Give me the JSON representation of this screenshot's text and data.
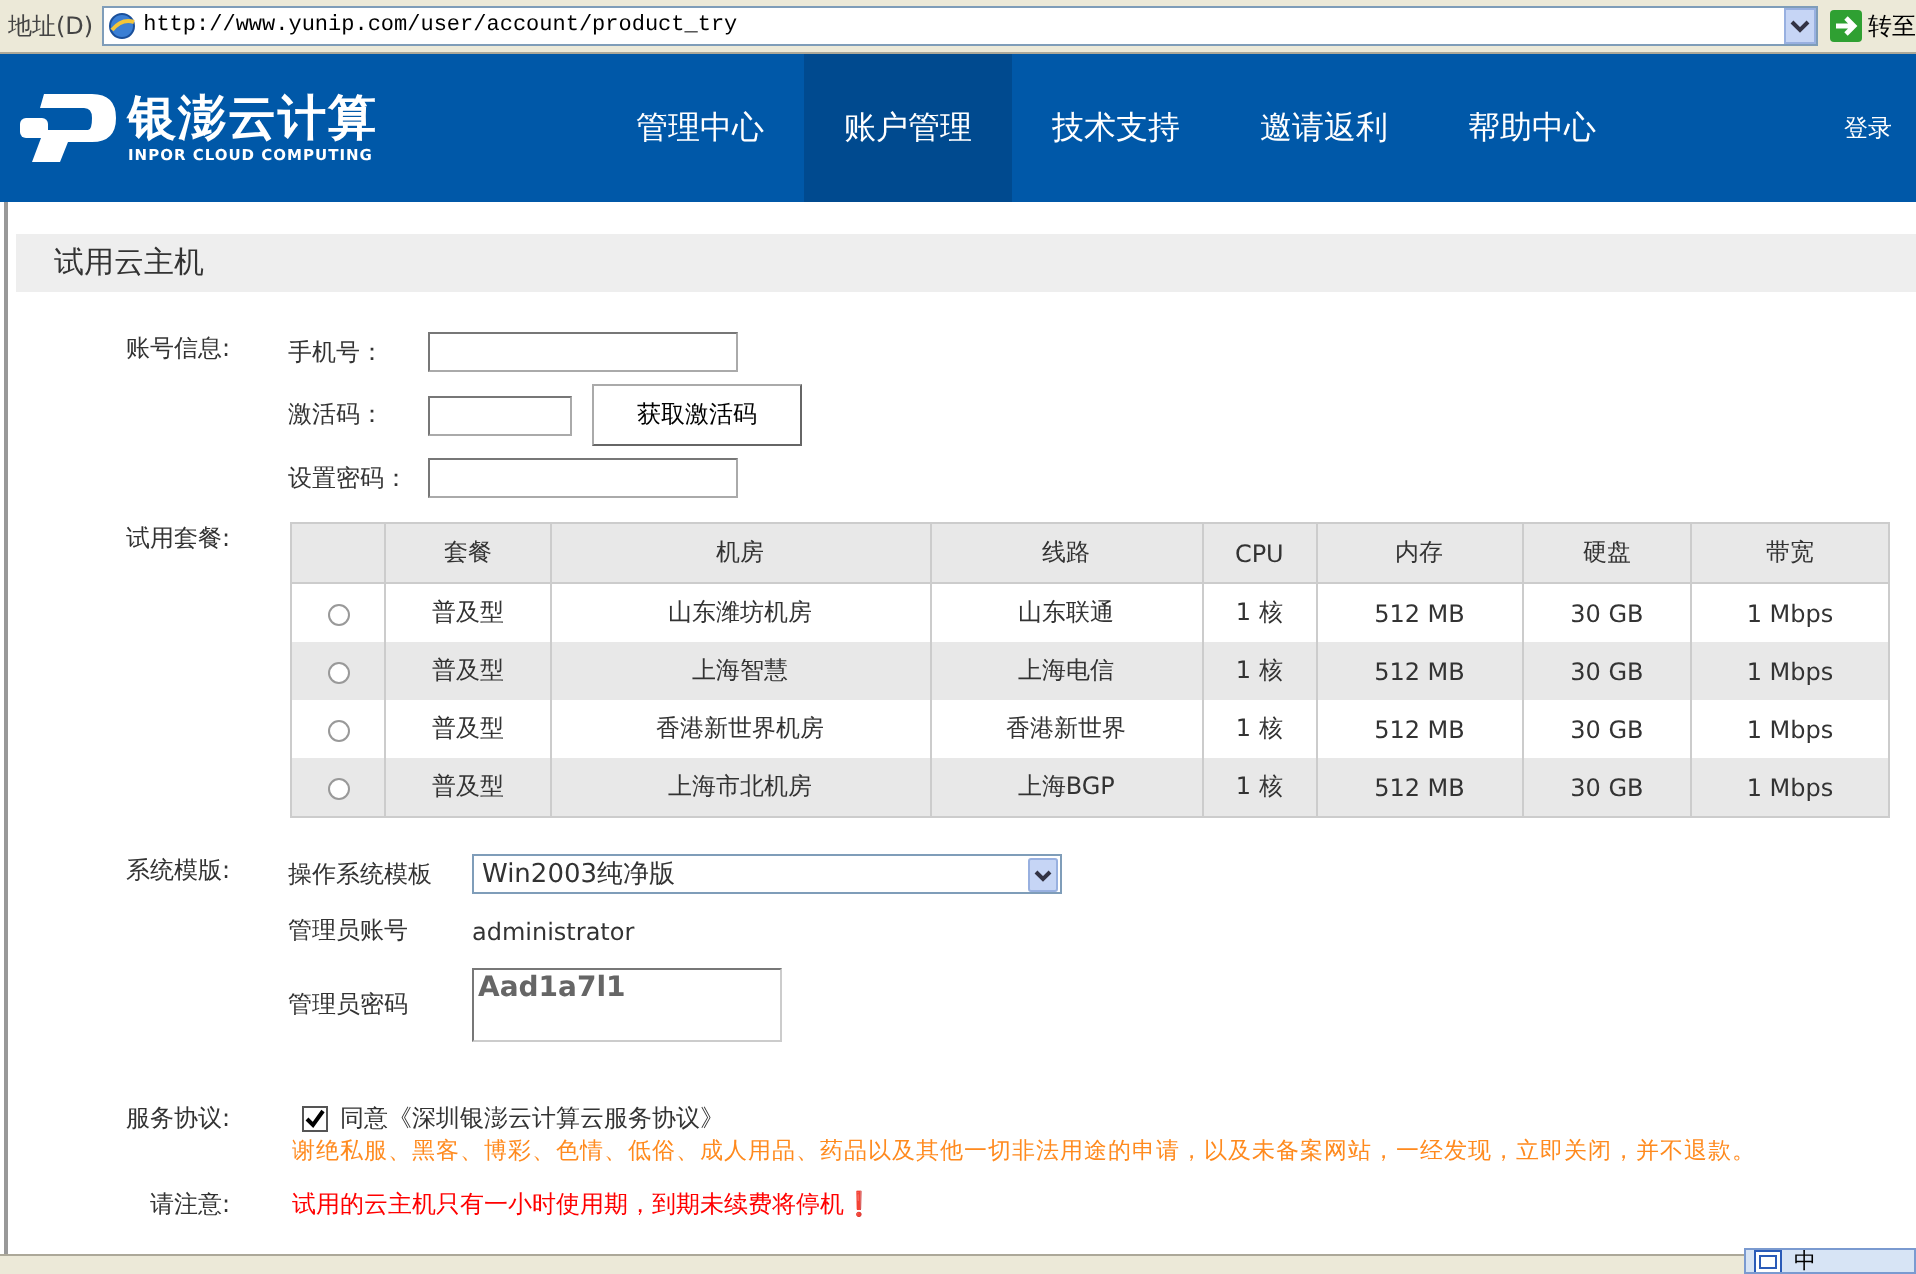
{
  "address_bar": {
    "label": "地址(D)",
    "url": "http://www.yunip.com/user/account/product_try",
    "go_label": "转至"
  },
  "nav": {
    "logo_text": "银澎云计算",
    "logo_subtitle": "INPOR CLOUD COMPUTING",
    "items": [
      {
        "label": "管理中心",
        "selected": false
      },
      {
        "label": "账户管理",
        "selected": true
      },
      {
        "label": "技术支持",
        "selected": false
      },
      {
        "label": "邀请返利",
        "selected": false
      },
      {
        "label": "帮助中心",
        "selected": false
      }
    ],
    "login": "登录"
  },
  "page_title": "试用云主机",
  "account": {
    "label": "账号信息:",
    "phone_label": "手机号：",
    "code_label": "激活码：",
    "get_code_button": "获取激活码",
    "password_label": "设置密码："
  },
  "plans": {
    "label": "试用套餐:",
    "columns": [
      "套餐",
      "机房",
      "线路",
      "CPU",
      "内存",
      "硬盘",
      "带宽"
    ],
    "rows": [
      {
        "selected": false,
        "cells": [
          "普及型",
          "山东潍坊机房",
          "山东联通",
          "1 核",
          "512 MB",
          "30 GB",
          "1 Mbps"
        ]
      },
      {
        "selected": false,
        "cells": [
          "普及型",
          "上海智慧",
          "上海电信",
          "1 核",
          "512 MB",
          "30 GB",
          "1 Mbps"
        ]
      },
      {
        "selected": false,
        "cells": [
          "普及型",
          "香港新世界机房",
          "香港新世界",
          "1 核",
          "512 MB",
          "30 GB",
          "1 Mbps"
        ]
      },
      {
        "selected": false,
        "cells": [
          "普及型",
          "上海市北机房",
          "上海BGP",
          "1 核",
          "512 MB",
          "30 GB",
          "1 Mbps"
        ]
      }
    ]
  },
  "template": {
    "label": "系统模版:",
    "os_label": "操作系统模板",
    "os_value": "Win2003纯净版",
    "admin_account_label": "管理员账号",
    "admin_account": "administrator",
    "admin_password_label": "管理员密码",
    "admin_password": "Aad1a7l1"
  },
  "agreement": {
    "label": "服务协议:",
    "checked": true,
    "text": "同意《深圳银澎云计算云服务协议》",
    "warning": "谢绝私服、黑客、博彩、色情、低俗、成人用品、药品以及其他一切非法用途的申请，以及未备案网站，一经发现，立即关闭，并不退款。"
  },
  "notice": {
    "label": "请注意:",
    "text": "试用的云主机只有一小时使用期，到期未续费将停机❗"
  },
  "status_bar": {
    "ime": "中"
  }
}
